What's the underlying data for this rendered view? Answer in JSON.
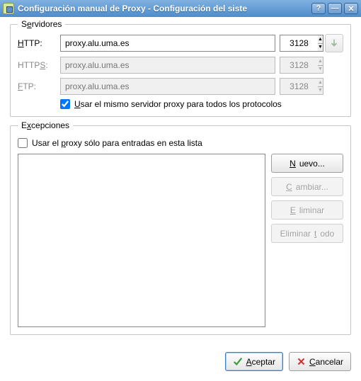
{
  "window": {
    "title": "Configuración manual de Proxy - Configuración del siste",
    "help_glyph": "?",
    "min_glyph": "—",
    "close_glyph": "✕"
  },
  "servers": {
    "legend_pre": "S",
    "legend_under": "e",
    "legend_post": "rvidores",
    "http_lbl_u": "H",
    "http_lbl_r": "TTP:",
    "https_lbl_pre": "HTTP",
    "https_lbl_u": "S",
    "https_lbl_post": ":",
    "ftp_lbl_u": "F",
    "ftp_lbl_r": "TP:",
    "http_host": "proxy.alu.uma.es",
    "https_ph": "proxy.alu.uma.es",
    "ftp_ph": "proxy.alu.uma.es",
    "http_port": "3128",
    "https_port": "3128",
    "ftp_port": "3128",
    "same_checked": true,
    "same_pre": "",
    "same_u": "U",
    "same_post": "sar el mismo servidor proxy para todos los protocolos"
  },
  "exceptions": {
    "legend_pre": "E",
    "legend_u": "x",
    "legend_post": "cepciones",
    "only_checked": false,
    "only_pre": "Usar el ",
    "only_u": "p",
    "only_post": "roxy sólo para entradas en esta lista",
    "btn_new_u": "N",
    "btn_new_r": "uevo...",
    "btn_change_u": "C",
    "btn_change_r": "ambiar...",
    "btn_delete_u": "E",
    "btn_delete_r": "liminar",
    "btn_delall_pre": "Eliminar ",
    "btn_delall_u": "t",
    "btn_delall_post": "odo"
  },
  "footer": {
    "ok_u": "A",
    "ok_r": "ceptar",
    "cancel_u": "C",
    "cancel_r": "ancelar"
  }
}
